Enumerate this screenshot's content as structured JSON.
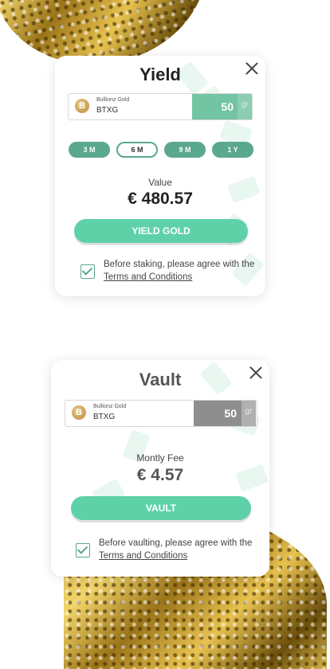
{
  "yield_card": {
    "title": "Yield",
    "asset_name": "Bullionz Gold",
    "asset_symbol": "BTXG",
    "amount": "50",
    "unit": "gr",
    "periods": [
      "3 M",
      "6 M",
      "9 M",
      "1 Y"
    ],
    "selected_period": "6 M",
    "value_label": "Value",
    "value": "€ 480.57",
    "button_label": "YIELD GOLD",
    "agree_text": "Before staking, please agree with the",
    "terms_link": "Terms and Conditions"
  },
  "vault_card": {
    "title": "Vault",
    "asset_name": "Bullionz Gold",
    "asset_symbol": "BTXG",
    "amount": "50",
    "unit": "gr",
    "fee_label": "Montly Fee",
    "fee_value": "€ 4.57",
    "button_label": "VAULT",
    "agree_text": "Before vaulting, please agree with the",
    "terms_link": "Terms and Conditions"
  },
  "colors": {
    "accent": "#5fd1a8",
    "accent_dark": "#5aa88d",
    "vault_amount_bg": "#8e8e8e"
  },
  "icons": [
    "close-icon",
    "bitcoin-coin-icon",
    "checkmark-icon"
  ]
}
